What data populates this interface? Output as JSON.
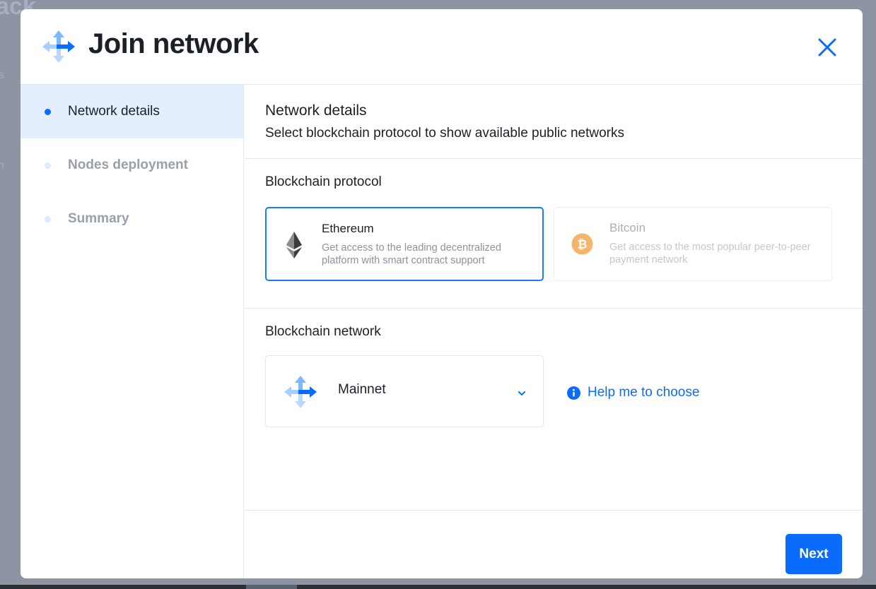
{
  "backdrop": {
    "text": "ack",
    "marks": [
      "s",
      "n"
    ]
  },
  "modal": {
    "title": "Join network",
    "close_icon": "close-icon",
    "logo_icon": "network-arrows-logo-icon"
  },
  "sidebar": {
    "steps": [
      {
        "label": "Network details",
        "active": true
      },
      {
        "label": "Nodes deployment",
        "active": false
      },
      {
        "label": "Summary",
        "active": false
      }
    ]
  },
  "content": {
    "heading": "Network details",
    "subheading": "Select blockchain protocol to show available public networks",
    "protocol": {
      "label": "Blockchain protocol",
      "options": [
        {
          "title": "Ethereum",
          "description": "Get access to the leading decentralized platform with smart contract support",
          "icon": "ethereum-icon",
          "selected": true
        },
        {
          "title": "Bitcoin",
          "description": "Get access to the most popular peer-to-peer payment network",
          "icon": "bitcoin-icon",
          "selected": false,
          "disabled": true
        }
      ]
    },
    "network": {
      "label": "Blockchain network",
      "selected": "Mainnet",
      "help_link": "Help me to choose"
    }
  },
  "footer": {
    "next_label": "Next"
  },
  "colors": {
    "accent": "#0a6cff",
    "bitcoin": "#f7a54d",
    "active_step_bg": "#e3efff"
  }
}
